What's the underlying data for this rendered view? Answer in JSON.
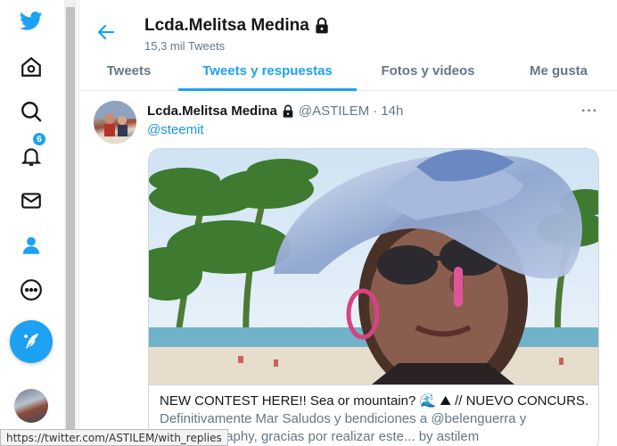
{
  "colors": {
    "accent": "#1da1f2",
    "text": "#14171a",
    "muted": "#657786",
    "border": "#e6ecf0"
  },
  "nav": {
    "items": [
      {
        "icon": "twitter-logo-icon"
      },
      {
        "icon": "home-icon"
      },
      {
        "icon": "explore-icon"
      },
      {
        "icon": "notifications-icon",
        "badge": "6"
      },
      {
        "icon": "messages-icon"
      },
      {
        "icon": "profile-icon"
      },
      {
        "icon": "more-icon"
      },
      {
        "icon": "compose-tweet-icon"
      }
    ]
  },
  "header": {
    "name": "Lcda.Melitsa Medina",
    "tweet_count": "15,3 mil Tweets"
  },
  "tabs": [
    {
      "label": "Tweets",
      "active": false
    },
    {
      "label": "Tweets y respuestas",
      "active": true
    },
    {
      "label": "Fotos y videos",
      "active": false
    },
    {
      "label": "Me gusta",
      "active": false
    }
  ],
  "tweet": {
    "name": "Lcda.Melitsa Medina",
    "handle": "@ASTILEM",
    "separator": "·",
    "time": "14h",
    "more": "···",
    "text": "@steemit",
    "card": {
      "title": "NEW CONTEST HERE!! Sea or mountain? 🌊 ⛰ // NUEVO CONCURS...",
      "description": "Definitivamente Mar Saludos y bendiciones a @belenguerra y worldgeography, gracias por realizar este... by astilem"
    }
  },
  "statusbar": {
    "url": "https://twitter.com/ASTILEM/with_replies"
  }
}
